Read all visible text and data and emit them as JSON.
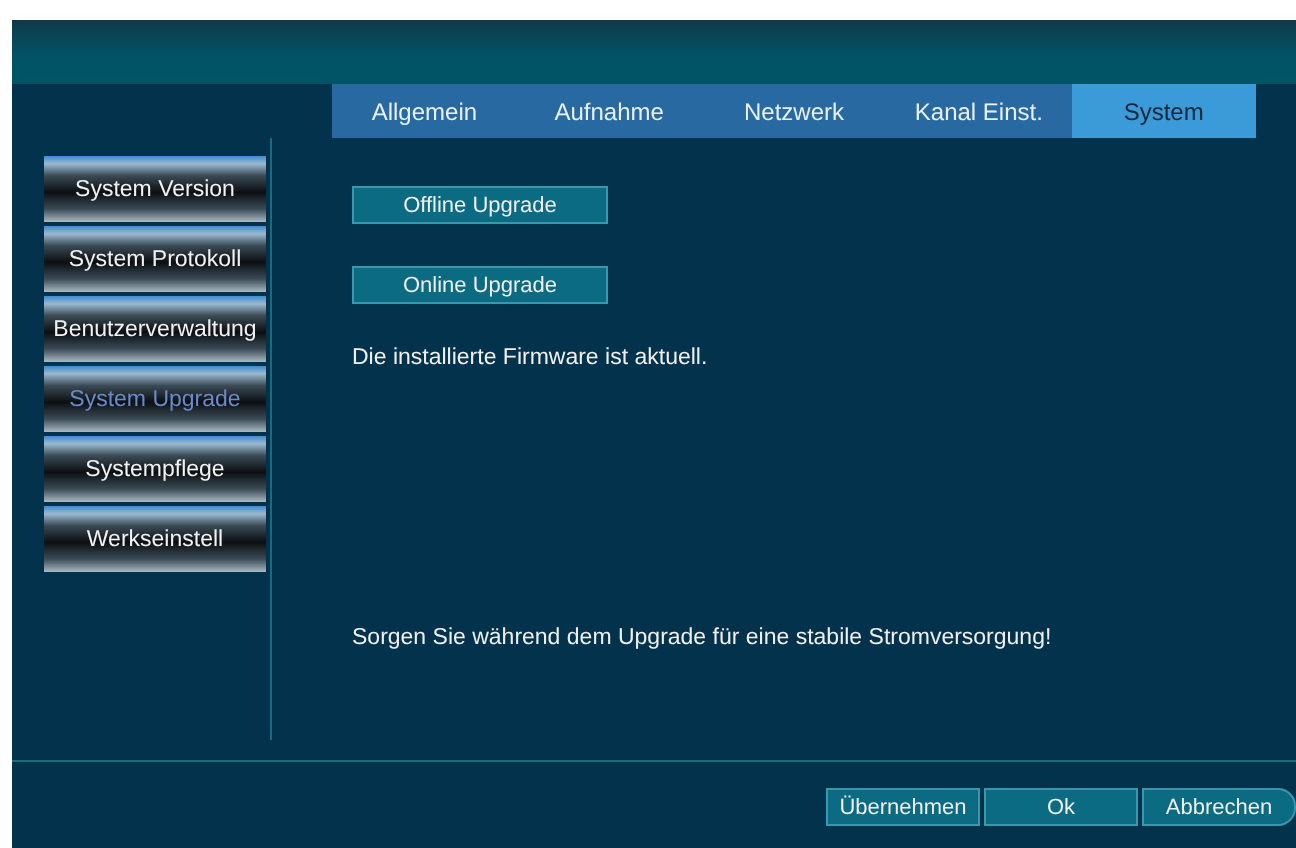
{
  "tabs": [
    {
      "label": "Allgemein",
      "selected": false
    },
    {
      "label": "Aufnahme",
      "selected": false
    },
    {
      "label": "Netzwerk",
      "selected": false
    },
    {
      "label": "Kanal Einst.",
      "selected": false
    },
    {
      "label": "System",
      "selected": true
    }
  ],
  "sidebar": {
    "items": [
      {
        "label": "System Version",
        "selected": false
      },
      {
        "label": "System Protokoll",
        "selected": false
      },
      {
        "label": "Benutzerverwaltung",
        "selected": false
      },
      {
        "label": "System Upgrade",
        "selected": true
      },
      {
        "label": "Systempflege",
        "selected": false
      },
      {
        "label": "Werkseinstell",
        "selected": false
      }
    ]
  },
  "content": {
    "buttons": [
      "Offline Upgrade",
      "Online Upgrade"
    ],
    "status": "Die installierte Firmware ist aktuell.",
    "notice": "Sorgen Sie während dem Upgrade für eine stabile Stromversorgung!"
  },
  "footer_buttons": [
    "Übernehmen",
    "Ok",
    "Abbrechen"
  ]
}
